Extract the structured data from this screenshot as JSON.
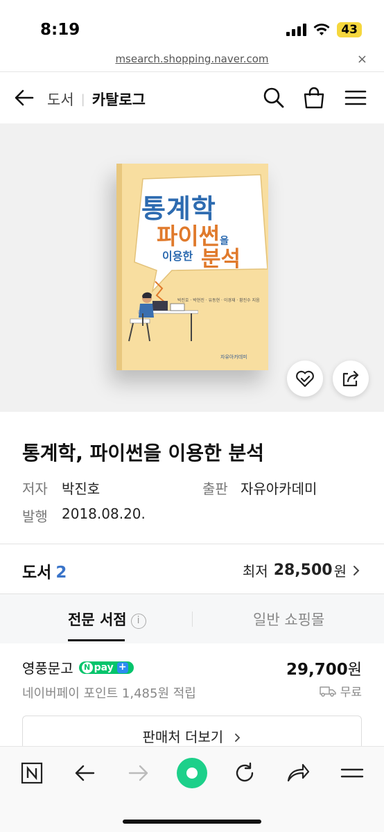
{
  "status": {
    "time": "8:19",
    "battery": "43"
  },
  "browser": {
    "url": "msearch.shopping.naver.com",
    "close": "×"
  },
  "header": {
    "category": "도서",
    "title": "카탈로그"
  },
  "cover": {
    "line1": "통계학",
    "line2": "파이썬",
    "line2_suffix": "을",
    "line3": "이용한",
    "line4": "분석",
    "authors": "박진호 · 박현진 · 유동현 · 이경재 · 황진수 지음",
    "publisher": "자유아카데미"
  },
  "product": {
    "title": "통계학, 파이썬을 이용한 분석",
    "author_label": "저자",
    "author": "박진호",
    "publisher_label": "출판",
    "publisher": "자유아카데미",
    "date_label": "발행",
    "date": "2018.08.20."
  },
  "price_summary": {
    "category": "도서",
    "count": "2",
    "lowest_label": "최저",
    "lowest_price": "28,500",
    "currency": "원"
  },
  "tabs": [
    {
      "label": "전문 서점",
      "active": true
    },
    {
      "label": "일반 쇼핑몰",
      "active": false
    }
  ],
  "store": {
    "name": "영풍문고",
    "npay_label": "pay",
    "price": "29,700",
    "currency": "원",
    "points": "네이버페이 포인트 1,485원 적립",
    "shipping": "무료"
  },
  "more_button": "판매처 더보기",
  "colors": {
    "accent_blue": "#3a74c9",
    "npay_green": "#05c46b",
    "hero_bg": "#f1f1f1"
  }
}
